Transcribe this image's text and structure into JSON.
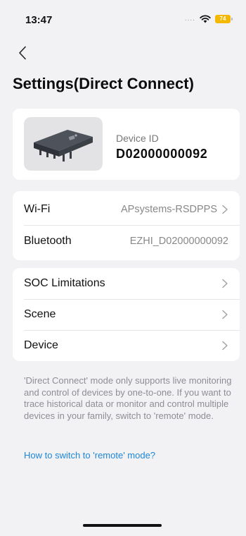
{
  "status_bar": {
    "time": "13:47",
    "signal": "....",
    "battery": "74"
  },
  "nav": {
    "back_icon": "chevron-left-icon"
  },
  "page": {
    "title": "Settings(Direct Connect)"
  },
  "device": {
    "id_label": "Device ID",
    "id_value": "D02000000092",
    "image_icon": "microinverter-device"
  },
  "connections": [
    {
      "label": "Wi-Fi",
      "value": "APsystems-RSDPPS",
      "chevron": true
    },
    {
      "label": "Bluetooth",
      "value": "EZHI_D02000000092",
      "chevron": false
    }
  ],
  "settings": [
    {
      "label": "SOC Limitations"
    },
    {
      "label": "Scene"
    },
    {
      "label": "Device"
    }
  ],
  "info": {
    "text": "'Direct Connect' mode only supports live monitoring and control of devices by one-to-one. If you want to trace historical data or monitor and control multiple devices in your family, switch to 'remote' mode.",
    "link": "How to switch to 'remote' mode?"
  },
  "colors": {
    "background": "#f2f2f5",
    "card": "#ffffff",
    "link": "#1d86d8",
    "battery": "#f5b800",
    "secondary_text": "#888888"
  }
}
